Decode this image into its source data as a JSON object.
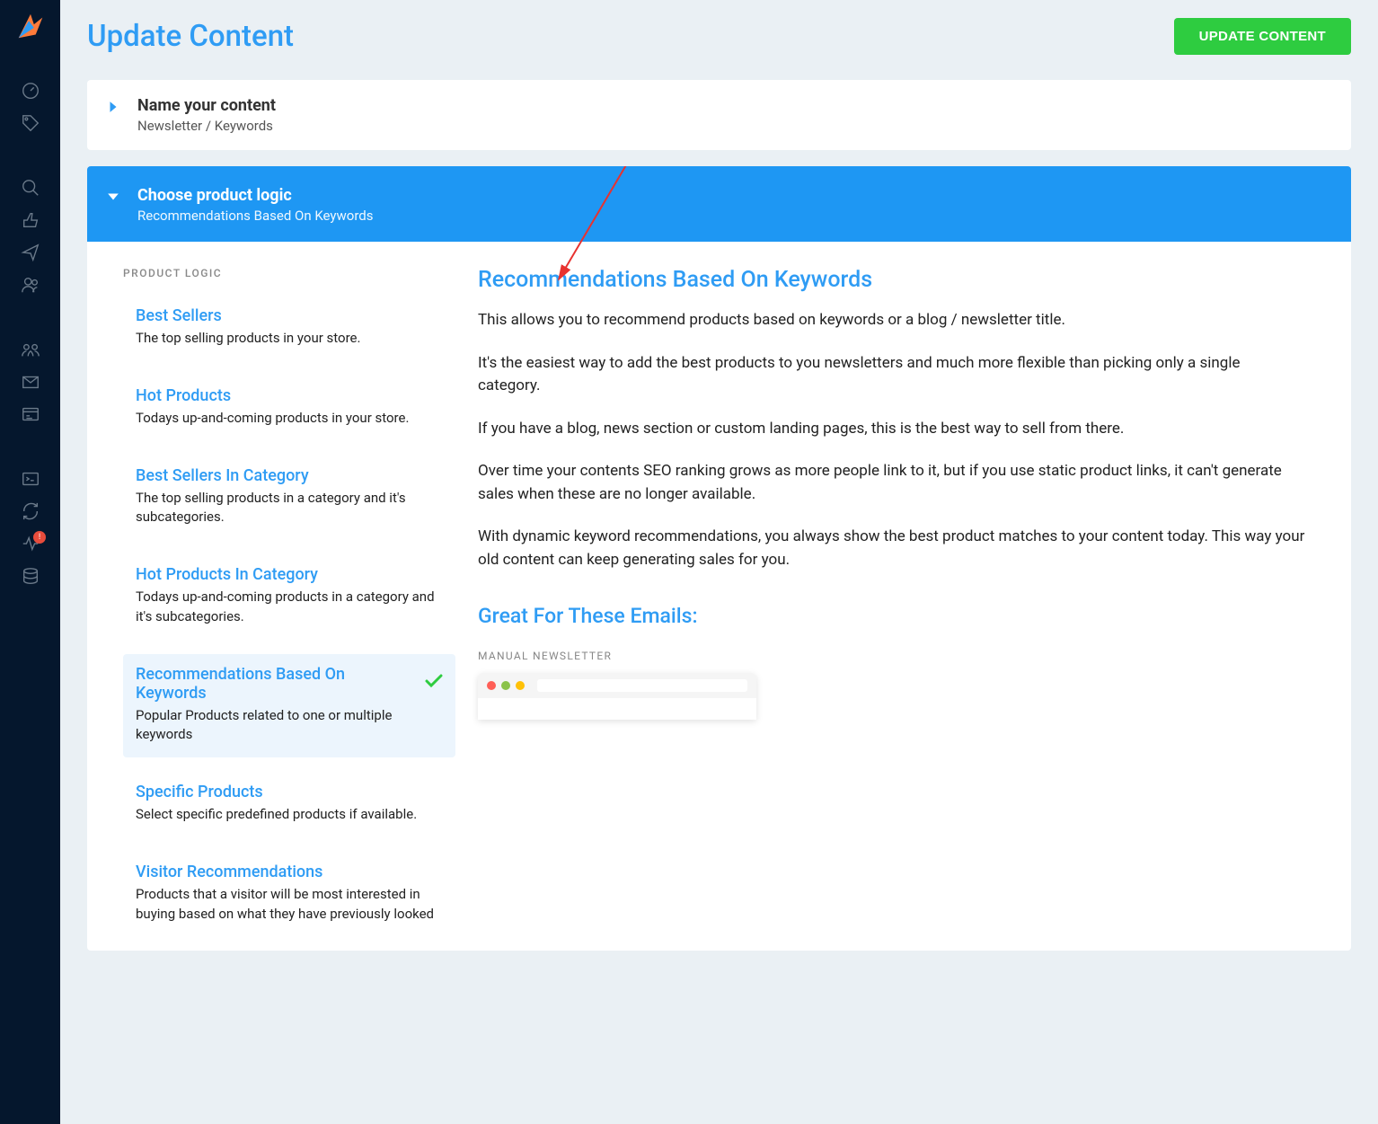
{
  "header": {
    "title": "Update Content",
    "buttonLabel": "UPDATE CONTENT"
  },
  "panels": {
    "name": {
      "title": "Name your content",
      "subtitle": "Newsletter / Keywords"
    },
    "logic": {
      "title": "Choose product logic",
      "subtitle": "Recommendations Based On Keywords"
    }
  },
  "sectionLabel": "PRODUCT LOGIC",
  "logicItems": [
    {
      "title": "Best Sellers",
      "desc": "The top selling products in your store.",
      "selected": false
    },
    {
      "title": "Hot Products",
      "desc": "Todays up-and-coming products in your store.",
      "selected": false
    },
    {
      "title": "Best Sellers In Category",
      "desc": "The top selling products in a category and it's subcategories.",
      "selected": false
    },
    {
      "title": "Hot Products In Category",
      "desc": "Todays up-and-coming products in a category and it's subcategories.",
      "selected": false
    },
    {
      "title": "Recommendations Based On Keywords",
      "desc": "Popular Products related to one or multiple keywords",
      "selected": true
    },
    {
      "title": "Specific Products",
      "desc": "Select specific predefined products if available.",
      "selected": false
    },
    {
      "title": "Visitor Recommendations",
      "desc": "Products that a visitor will be most interested in buying based on what they have previously looked",
      "selected": false
    }
  ],
  "detail": {
    "heading": "Recommendations Based On Keywords",
    "paragraphs": [
      "This allows you to recommend products based on keywords or a blog / newsletter title.",
      "It's the easiest way to add the best products to you newsletters and much more flexible than picking only a single category.",
      "If you have a blog, news section or custom landing pages, this is the best way to sell from there.",
      "Over time your contents SEO ranking grows as more people link to it, but if you use static product links, it can't generate sales when these are no longer available.",
      "With dynamic keyword recommendations, you always show the best product matches to your content today. This way your old content can keep generating sales for you."
    ],
    "subheading": "Great For These Emails:",
    "emailLabel": "MANUAL NEWSLETTER"
  },
  "browserDots": [
    "#ff5f57",
    "#8bc34a",
    "#ffc107"
  ]
}
